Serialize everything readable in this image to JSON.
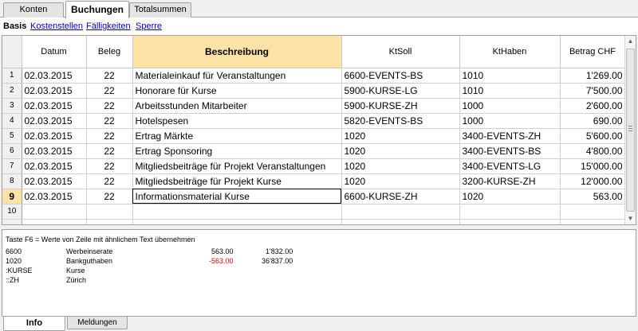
{
  "top_tabs": [
    {
      "label": "Konten",
      "active": false
    },
    {
      "label": "Buchungen",
      "active": true
    },
    {
      "label": "Totalsummen",
      "active": false
    }
  ],
  "views": [
    {
      "label": "Basis",
      "active": true
    },
    {
      "label": "Kostenstellen",
      "active": false
    },
    {
      "label": "Fälligkeiten",
      "active": false
    },
    {
      "label": "Sperre",
      "active": false
    }
  ],
  "table": {
    "columns": [
      "Datum",
      "Beleg",
      "Beschreibung",
      "KtSoll",
      "KtHaben",
      "Betrag CHF"
    ],
    "selected_column": "Beschreibung",
    "current_row": 9,
    "rows": [
      {
        "n": "1",
        "datum": "02.03.2015",
        "beleg": "22",
        "beschreibung": "Materialeinkauf für Veranstaltungen",
        "ktsoll": "6600-EVENTS-BS",
        "kthaben": "1010",
        "betrag": "1'269.00"
      },
      {
        "n": "2",
        "datum": "02.03.2015",
        "beleg": "22",
        "beschreibung": "Honorare für Kurse",
        "ktsoll": "5900-KURSE-LG",
        "kthaben": "1010",
        "betrag": "7'500.00"
      },
      {
        "n": "3",
        "datum": "02.03.2015",
        "beleg": "22",
        "beschreibung": "Arbeitsstunden Mitarbeiter",
        "ktsoll": "5900-KURSE-ZH",
        "kthaben": "1000",
        "betrag": "2'600.00"
      },
      {
        "n": "4",
        "datum": "02.03.2015",
        "beleg": "22",
        "beschreibung": "Hotelspesen",
        "ktsoll": "5820-EVENTS-BS",
        "kthaben": "1000",
        "betrag": "690.00"
      },
      {
        "n": "5",
        "datum": "02.03.2015",
        "beleg": "22",
        "beschreibung": "Ertrag Märkte",
        "ktsoll": "1020",
        "kthaben": "3400-EVENTS-ZH",
        "betrag": "5'600.00"
      },
      {
        "n": "6",
        "datum": "02.03.2015",
        "beleg": "22",
        "beschreibung": "Ertrag Sponsoring",
        "ktsoll": "1020",
        "kthaben": "3400-EVENTS-BS",
        "betrag": "4'800.00"
      },
      {
        "n": "7",
        "datum": "02.03.2015",
        "beleg": "22",
        "beschreibung": "Mitgliedsbeiträge für Projekt Veranstaltungen",
        "ktsoll": "1020",
        "kthaben": "3400-EVENTS-LG",
        "betrag": "15'000.00"
      },
      {
        "n": "8",
        "datum": "02.03.2015",
        "beleg": "22",
        "beschreibung": "Mitgliedsbeiträge für Projekt Kurse",
        "ktsoll": "1020",
        "kthaben": "3200-KURSE-ZH",
        "betrag": "12'000.00"
      },
      {
        "n": "9",
        "datum": "02.03.2015",
        "beleg": "22",
        "beschreibung": "Informationsmaterial Kurse",
        "ktsoll": "6600-KURSE-ZH",
        "kthaben": "1020",
        "betrag": "563.00"
      },
      {
        "n": "10",
        "datum": "",
        "beleg": "",
        "beschreibung": "",
        "ktsoll": "",
        "kthaben": "",
        "betrag": ""
      }
    ]
  },
  "info": {
    "hint": "Taste F6 = Werte von Zeile mit ähnlichem Text übernehmen",
    "lines": [
      {
        "code": "6600",
        "name": "Werbeinserate",
        "amount": "563.00",
        "balance": "1'832.00",
        "negative": false
      },
      {
        "code": "1020",
        "name": "Bankguthaben",
        "amount": "-563.00",
        "balance": "36'837.00",
        "negative": true
      },
      {
        "code": ":KURSE",
        "name": "Kurse",
        "amount": "",
        "balance": "",
        "negative": false
      },
      {
        "code": "::ZH",
        "name": "Zürich",
        "amount": "",
        "balance": "",
        "negative": false
      }
    ]
  },
  "bottom_tabs": [
    {
      "label": "Info",
      "active": true
    },
    {
      "label": "Meldungen",
      "active": false
    }
  ],
  "colors": {
    "selected_header": "#fde2a6",
    "link": "#0000cc",
    "negative": "#e00000"
  },
  "icons": {
    "scroll_up": "scroll-up-arrow-icon",
    "scroll_down": "scroll-down-arrow-icon",
    "grip": "scrollbar-grip-icon"
  }
}
